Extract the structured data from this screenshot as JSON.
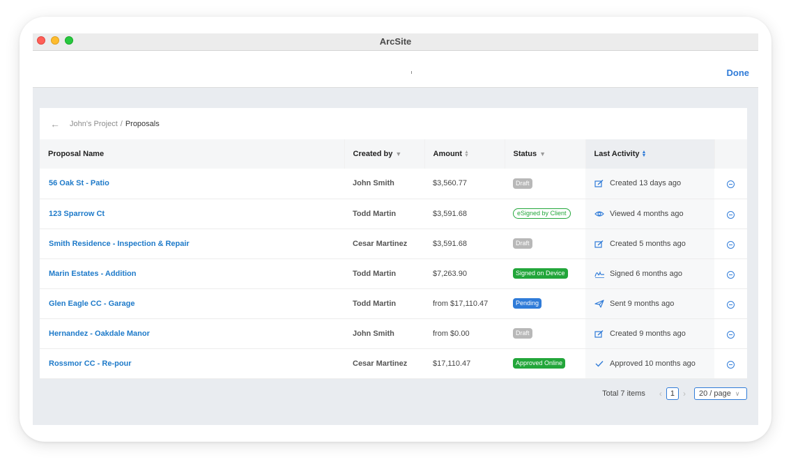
{
  "window": {
    "title": "ArcSite",
    "done_label": "Done"
  },
  "breadcrumb": {
    "parent": "John's Project",
    "separator": "/",
    "current": "Proposals"
  },
  "table": {
    "columns": {
      "name": "Proposal Name",
      "created_by": "Created by",
      "amount": "Amount",
      "status": "Status",
      "last_activity": "Last Activity"
    },
    "rows": [
      {
        "name": "56 Oak St - Patio",
        "created_by": "John Smith",
        "amount": "$3,560.77",
        "status": "Draft",
        "status_style": "draft",
        "activity_icon": "edit-icon",
        "activity": "Created 13 days ago"
      },
      {
        "name": "123 Sparrow Ct",
        "created_by": "Todd Martin",
        "amount": "$3,591.68",
        "status": "eSigned by Client",
        "status_style": "esigned",
        "activity_icon": "eye-icon",
        "activity": "Viewed 4 months ago"
      },
      {
        "name": "Smith Residence - Inspection & Repair",
        "created_by": "Cesar Martinez",
        "amount": "$3,591.68",
        "status": "Draft",
        "status_style": "draft",
        "activity_icon": "edit-icon",
        "activity": "Created 5 months ago"
      },
      {
        "name": "Marin Estates - Addition",
        "created_by": "Todd Martin",
        "amount": "$7,263.90",
        "status": "Signed on Device",
        "status_style": "signed",
        "activity_icon": "signature-icon",
        "activity": "Signed 6 months ago"
      },
      {
        "name": "Glen Eagle CC - Garage",
        "created_by": "Todd Martin",
        "amount": "from $17,110.47",
        "status": "Pending",
        "status_style": "pending",
        "activity_icon": "send-icon",
        "activity": "Sent 9 months ago"
      },
      {
        "name": "Hernandez - Oakdale Manor",
        "created_by": "John Smith",
        "amount": "from $0.00",
        "status": "Draft",
        "status_style": "draft",
        "activity_icon": "edit-icon",
        "activity": "Created 9 months ago"
      },
      {
        "name": "Rossmor CC - Re-pour",
        "created_by": "Cesar Martinez",
        "amount": "$17,110.47",
        "status": "Approved Online",
        "status_style": "approved",
        "activity_icon": "check-icon",
        "activity": "Approved 10 months ago"
      }
    ]
  },
  "pagination": {
    "total": "Total 7 items",
    "current_page": "1",
    "page_size": "20 / page"
  },
  "colors": {
    "accent": "#2f7bd8",
    "link": "#1e7ac9",
    "draft": "#b8b8b8",
    "signed": "#22a63a",
    "approved": "#22a63a",
    "pending": "#2f7bd8",
    "esigned_border": "#22a63a"
  }
}
